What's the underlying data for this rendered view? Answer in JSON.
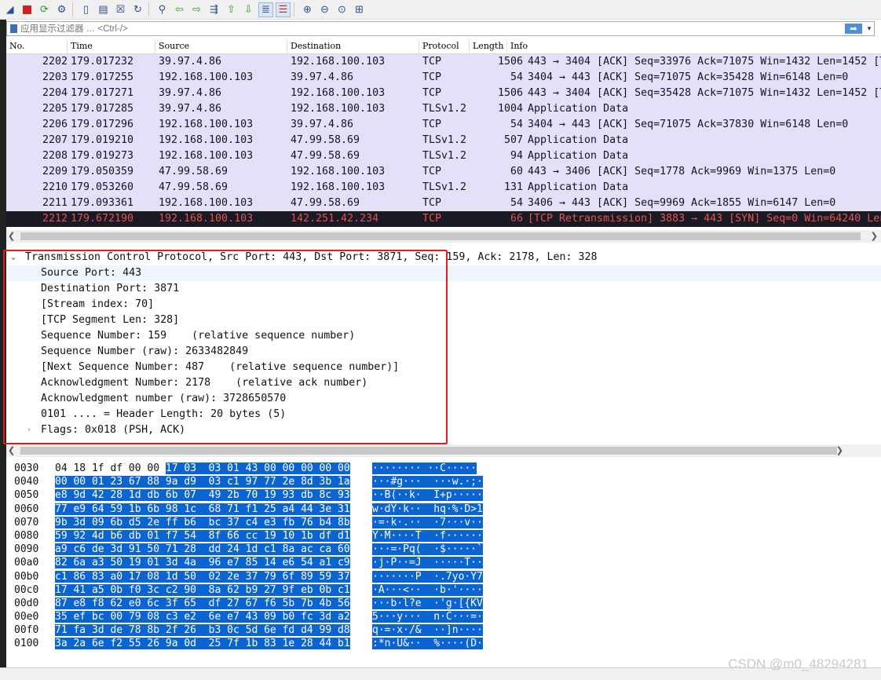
{
  "filter": {
    "placeholder": "应用显示过滤器 … <Ctrl-/>",
    "apply_glyph": "➡",
    "dropdown_glyph": "▾"
  },
  "columns": {
    "no": "No.",
    "time": "Time",
    "source": "Source",
    "destination": "Destination",
    "protocol": "Protocol",
    "length": "Length",
    "info": "Info"
  },
  "packets": [
    {
      "no": "2202",
      "time": "179.017232",
      "src": "39.97.4.86",
      "dst": "192.168.100.103",
      "proto": "TCP",
      "len": "1506",
      "info": "443 → 3404 [ACK] Seq=33976 Ack=71075 Win=1432 Len=1452 [TCP"
    },
    {
      "no": "2203",
      "time": "179.017255",
      "src": "192.168.100.103",
      "dst": "39.97.4.86",
      "proto": "TCP",
      "len": "54",
      "info": "3404 → 443 [ACK] Seq=71075 Ack=35428 Win=6148 Len=0"
    },
    {
      "no": "2204",
      "time": "179.017271",
      "src": "39.97.4.86",
      "dst": "192.168.100.103",
      "proto": "TCP",
      "len": "1506",
      "info": "443 → 3404 [ACK] Seq=35428 Ack=71075 Win=1432 Len=1452 [TCP"
    },
    {
      "no": "2205",
      "time": "179.017285",
      "src": "39.97.4.86",
      "dst": "192.168.100.103",
      "proto": "TLSv1.2",
      "len": "1004",
      "info": "Application Data"
    },
    {
      "no": "2206",
      "time": "179.017296",
      "src": "192.168.100.103",
      "dst": "39.97.4.86",
      "proto": "TCP",
      "len": "54",
      "info": "3404 → 443 [ACK] Seq=71075 Ack=37830 Win=6148 Len=0"
    },
    {
      "no": "2207",
      "time": "179.019210",
      "src": "192.168.100.103",
      "dst": "47.99.58.69",
      "proto": "TLSv1.2",
      "len": "507",
      "info": "Application Data"
    },
    {
      "no": "2208",
      "time": "179.019273",
      "src": "192.168.100.103",
      "dst": "47.99.58.69",
      "proto": "TLSv1.2",
      "len": "94",
      "info": "Application Data"
    },
    {
      "no": "2209",
      "time": "179.050359",
      "src": "47.99.58.69",
      "dst": "192.168.100.103",
      "proto": "TCP",
      "len": "60",
      "info": "443 → 3406 [ACK] Seq=1778 Ack=9969 Win=1375 Len=0"
    },
    {
      "no": "2210",
      "time": "179.053260",
      "src": "47.99.58.69",
      "dst": "192.168.100.103",
      "proto": "TLSv1.2",
      "len": "131",
      "info": "Application Data"
    },
    {
      "no": "2211",
      "time": "179.093361",
      "src": "192.168.100.103",
      "dst": "47.99.58.69",
      "proto": "TCP",
      "len": "54",
      "info": "3406 → 443 [ACK] Seq=9969 Ack=1855 Win=6147 Len=0"
    },
    {
      "no": "2212",
      "time": "179.672190",
      "src": "192.168.100.103",
      "dst": "142.251.42.234",
      "proto": "TCP",
      "len": "66",
      "info": "[TCP Retransmission] 3883 → 443 [SYN] Seq=0 Win=64240 Len=0"
    }
  ],
  "details": {
    "header": "Transmission Control Protocol, Src Port: 443, Dst Port: 3871, Seq: 159, Ack: 2178, Len: 328",
    "fields": [
      "Source Port: 443",
      "Destination Port: 3871",
      "[Stream index: 70]",
      "[TCP Segment Len: 328]",
      "Sequence Number: 159    (relative sequence number)",
      "Sequence Number (raw): 2633482849",
      "[Next Sequence Number: 487    (relative sequence number)]",
      "Acknowledgment Number: 2178    (relative ack number)",
      "Acknowledgment number (raw): 3728650570",
      "0101 .... = Header Length: 20 bytes (5)"
    ],
    "flags": "Flags: 0x018 (PSH, ACK)"
  },
  "bytes": [
    {
      "off": "0030",
      "hex_plain": "04 18 1f df 00 00 ",
      "hex_hl": "17 03  03 01 43 00 00 00 00 00",
      "asc_plain": "······",
      "asc_hl": "·· ··C·····"
    },
    {
      "off": "0040",
      "hex_plain": "",
      "hex_hl": "00 00 01 23 67 88 9a d9  03 c1 97 77 2e 8d 3b 1a",
      "asc_plain": "",
      "asc_hl": "···#g···  ···w.·;·"
    },
    {
      "off": "0050",
      "hex_plain": "",
      "hex_hl": "e8 9d 42 28 1d db 6b 07  49 2b 70 19 93 db 8c 93",
      "asc_plain": "",
      "asc_hl": "··B(··k·  I+p·····"
    },
    {
      "off": "0060",
      "hex_plain": "",
      "hex_hl": "77 e9 64 59 1b 6b 98 1c  68 71 f1 25 a4 44 3e 31",
      "asc_plain": "",
      "asc_hl": "w·dY·k··  hq·%·D>1"
    },
    {
      "off": "0070",
      "hex_plain": "",
      "hex_hl": "9b 3d 09 6b d5 2e ff b6  bc 37 c4 e3 fb 76 b4 8b",
      "asc_plain": "",
      "asc_hl": "·=·k·.··  ·7···v··"
    },
    {
      "off": "0080",
      "hex_plain": "",
      "hex_hl": "59 92 4d b6 db 01 f7 54  8f 66 cc 19 10 1b df d1",
      "asc_plain": "",
      "asc_hl": "Y·M····T  ·f······"
    },
    {
      "off": "0090",
      "hex_plain": "",
      "hex_hl": "a9 c6 de 3d 91 50 71 28  dd 24 1d c1 8a ac ca 60",
      "asc_plain": "",
      "asc_hl": "···=·Pq(  ·$·····`"
    },
    {
      "off": "00a0",
      "hex_plain": "",
      "hex_hl": "82 6a a3 50 19 01 3d 4a  96 e7 85 14 e6 54 a1 c9",
      "asc_plain": "",
      "asc_hl": "·j·P··=J  ·····T··"
    },
    {
      "off": "00b0",
      "hex_plain": "",
      "hex_hl": "c1 86 83 a0 17 08 1d 50  02 2e 37 79 6f 89 59 37",
      "asc_plain": "",
      "asc_hl": "·······P  ·.7yo·Y7"
    },
    {
      "off": "00c0",
      "hex_plain": "",
      "hex_hl": "17 41 a5 0b f0 3c c2 90  8a 62 b9 27 9f eb 0b c1",
      "asc_plain": "",
      "asc_hl": "·A···<··  ·b·'····"
    },
    {
      "off": "00d0",
      "hex_plain": "",
      "hex_hl": "87 e8 f8 62 e0 6c 3f 65  df 27 67 f6 5b 7b 4b 56",
      "asc_plain": "",
      "asc_hl": "···b·l?e  ·'g·[{KV"
    },
    {
      "off": "00e0",
      "hex_plain": "",
      "hex_hl": "35 ef bc 00 79 08 c3 e2  6e e7 43 09 b0 fc 3d a2",
      "asc_plain": "",
      "asc_hl": "5···y···  n·C···=·"
    },
    {
      "off": "00f0",
      "hex_plain": "",
      "hex_hl": "71 fa 3d de 78 8b 2f 26  b3 0c 5d 6e fd d4 99 d8",
      "asc_plain": "",
      "asc_hl": "q·=·x·/&  ··]n····"
    },
    {
      "off": "0100",
      "hex_plain": "",
      "hex_hl": "3a 2a 6e f2 55 26 9a 0d  25 7f 1b 83 1e 28 44 b1",
      "asc_plain": "",
      "asc_hl": ":*n·U&··  %····(D·"
    }
  ],
  "watermark": "CSDN @m0_48294281"
}
